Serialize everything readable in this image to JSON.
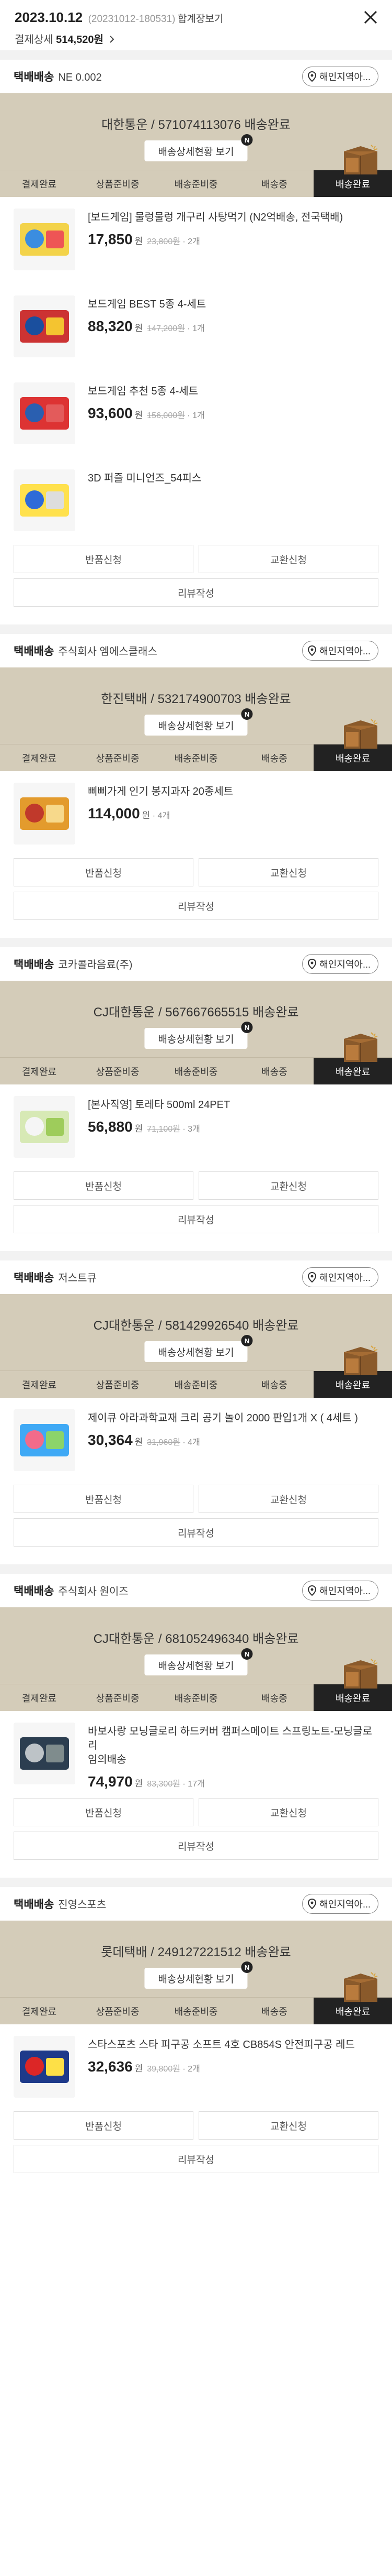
{
  "header": {
    "date": "2023.10.12",
    "code": "(20231012-180531)",
    "merge_label": "합계장보기",
    "paid_label": "결제상세",
    "paid_amount": "514,520원"
  },
  "common": {
    "help_label": "해인지역아...",
    "status_button": "배송상세현황 보기",
    "badge": "N",
    "steps": [
      "결제완료",
      "상품준비중",
      "배송준비중",
      "배송중",
      "배송완료"
    ],
    "return_label": "반품신청",
    "exchange_label": "교환신청",
    "review_label": "리뷰작성",
    "won": "원"
  },
  "orders": [
    {
      "ship_label": "택배배송",
      "shop": "NE 0.002",
      "carrier": "대한통운 / 571074113076 배송완료",
      "items": [
        {
          "name": "[보드게임] 물렁물렁 개구리 사탕먹기 (N2억배송, 전국택배)",
          "price": "17,850",
          "orig": "23,800원",
          "qty": "· 2개"
        },
        {
          "name": "보드게임 BEST 5종 4-세트",
          "price": "88,320",
          "orig": "147,200원",
          "qty": "· 1개"
        },
        {
          "name": "보드게임 추천 5종 4-세트",
          "price": "93,600",
          "orig": "156,000원",
          "qty": "· 1개"
        },
        {
          "name": "3D 퍼즐 미니언즈_54피스",
          "price": "",
          "orig": "",
          "qty": ""
        }
      ]
    },
    {
      "ship_label": "택배배송",
      "shop": "주식회사 엠에스클래스",
      "carrier": "한진택배 / 532174900703 배송완료",
      "items": [
        {
          "name": "삐삐가게 인기 봉지과자 20종세트",
          "brand": "삐삐가게",
          "price": "114,000",
          "orig": "",
          "qty": "· 4개"
        }
      ]
    },
    {
      "ship_label": "택배배송",
      "shop": "코카콜라음료(주)",
      "carrier": "CJ대한통운 / 567667665515 배송완료",
      "items": [
        {
          "name": "[본사직영] 토레타 500ml 24PET",
          "price": "56,880",
          "orig": "71,100원",
          "qty": "· 3개"
        }
      ]
    },
    {
      "ship_label": "택배배송",
      "shop": "저스트큐",
      "carrier": "CJ대한통운 / 581429926540 배송완료",
      "items": [
        {
          "name": "제이큐 아라과학교재 크리 공기 놀이 2000 판입1개 X ( 4세트 )",
          "brand": "제이큐",
          "price": "30,364",
          "orig": "31,960원",
          "qty": "· 4개"
        }
      ]
    },
    {
      "ship_label": "택배배송",
      "shop": "주식회사 원이즈",
      "carrier": "CJ대한통운 / 681052496340 배송완료",
      "items": [
        {
          "name": "바보사랑 모닝글로리 하드커버 캠퍼스메이트 스프링노트-모닝글로리",
          "brand": "바보사랑",
          "option": "임의배송",
          "price": "74,970",
          "orig": "83,300원",
          "qty": "· 17개"
        }
      ]
    },
    {
      "ship_label": "택배배송",
      "shop": "진영스포츠",
      "carrier": "롯데택배 / 249127221512 배송완료",
      "items": [
        {
          "name": "스타스포츠 스타 피구공 소프트 4호 CB854S 안전피구공 레드",
          "brand": "스타스포츠",
          "price": "32,636",
          "orig": "39,800원",
          "qty": "· 2개"
        }
      ]
    }
  ]
}
